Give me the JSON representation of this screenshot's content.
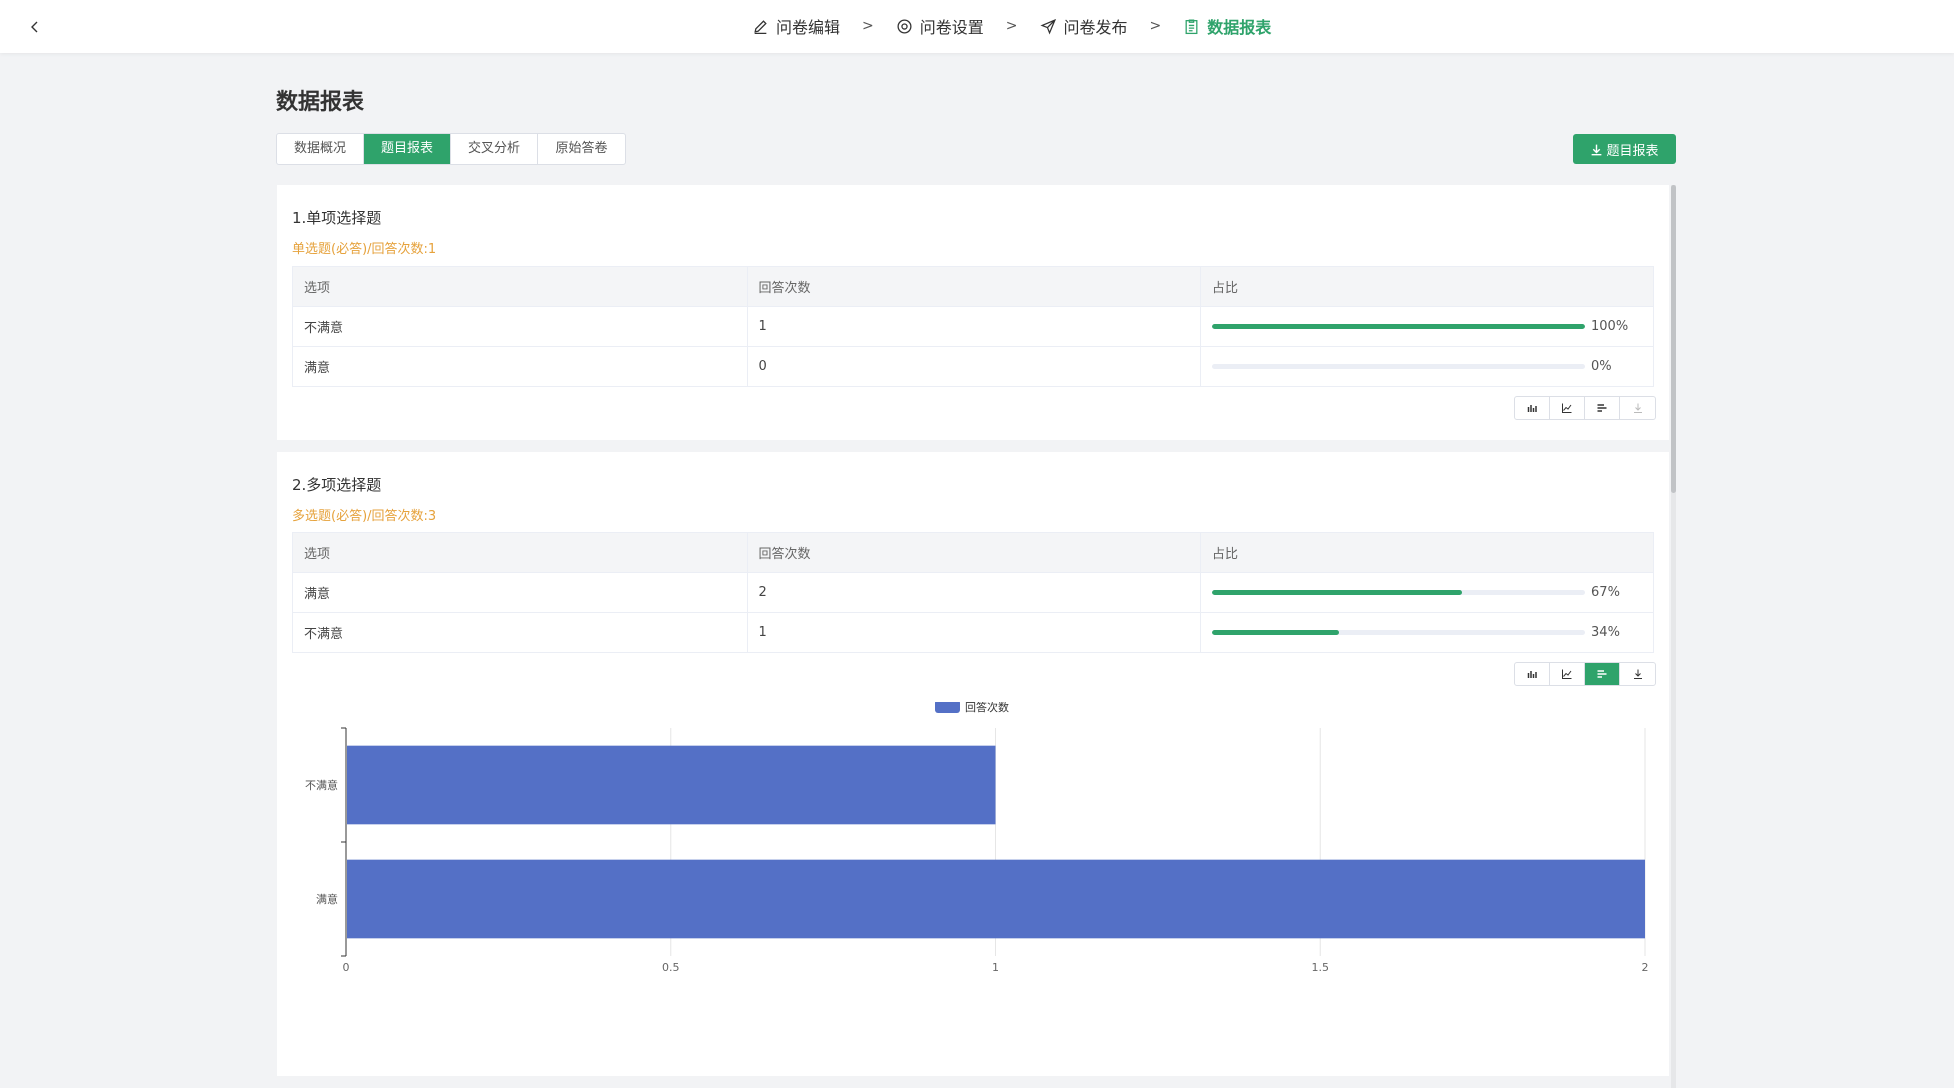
{
  "nav": {
    "steps": [
      {
        "label": "问卷编辑",
        "icon": "edit-icon"
      },
      {
        "label": "问卷设置",
        "icon": "settings-icon"
      },
      {
        "label": "问卷发布",
        "icon": "send-icon"
      },
      {
        "label": "数据报表",
        "icon": "report-icon"
      }
    ],
    "separator": ">",
    "active_index": 3
  },
  "page": {
    "title": "数据报表"
  },
  "tabs": [
    {
      "label": "数据概况"
    },
    {
      "label": "题目报表"
    },
    {
      "label": "交叉分析"
    },
    {
      "label": "原始答卷"
    }
  ],
  "active_tab": 1,
  "export_button": {
    "label": "题目报表",
    "icon": "download-icon"
  },
  "colors": {
    "accent": "#2fa36b",
    "warning": "#e6a23c",
    "bar": "#5470c6"
  },
  "table_headers": [
    "选项",
    "回答次数",
    "占比"
  ],
  "questions": [
    {
      "title": "1.单项选择题",
      "subtitle": "单选题(必答)/回答次数:1",
      "rows": [
        {
          "option": "不满意",
          "count": "1",
          "percent_label": "100%",
          "percent": 100
        },
        {
          "option": "满意",
          "count": "0",
          "percent_label": "0%",
          "percent": 0
        }
      ],
      "active_view": null
    },
    {
      "title": "2.多项选择题",
      "subtitle": "多选题(必答)/回答次数:3",
      "rows": [
        {
          "option": "满意",
          "count": "2",
          "percent_label": "67%",
          "percent": 67
        },
        {
          "option": "不满意",
          "count": "1",
          "percent_label": "34%",
          "percent": 34
        }
      ],
      "active_view": "horizontal-bar"
    }
  ],
  "chart_data": {
    "type": "bar",
    "orientation": "horizontal",
    "categories": [
      "不满意",
      "满意"
    ],
    "series": [
      {
        "name": "回答次数",
        "values": [
          1,
          2
        ]
      }
    ],
    "xlim": [
      0,
      2
    ],
    "xticks": [
      "0",
      "0.5",
      "1",
      "1.5",
      "2"
    ],
    "grid": true,
    "legend_position": "top-center"
  }
}
